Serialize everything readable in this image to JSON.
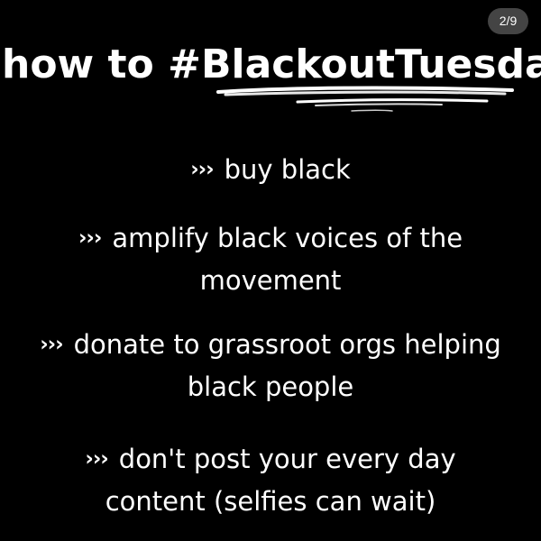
{
  "counter": "2/9",
  "title": "how to #BlackoutTuesday",
  "bullet_symbol": "›››",
  "items": [
    {
      "line1": "buy black",
      "line2": ""
    },
    {
      "line1": "amplify black voices of the",
      "line2": "movement"
    },
    {
      "line1": "donate to grassroot orgs helping",
      "line2": "black people"
    },
    {
      "line1": "don't post your every day",
      "line2": "content (selfies can wait)"
    }
  ],
  "colors": {
    "background": "#000000",
    "text": "#ffffff",
    "badge": "#505050"
  },
  "icons": {
    "bullet": "triple-chevron-right-icon",
    "underline": "brush-stroke-underline"
  }
}
